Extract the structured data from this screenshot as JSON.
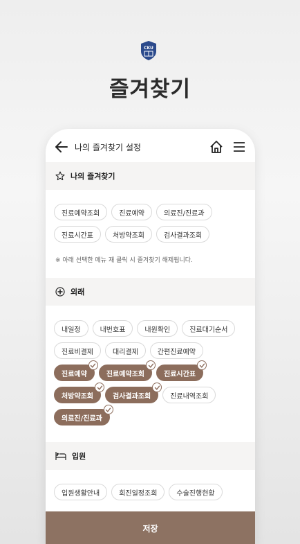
{
  "hero": {
    "logo_text": "CKU",
    "title": "즐겨찾기"
  },
  "appbar": {
    "title": "나의 즐겨찾기 설정"
  },
  "favorites": {
    "title": "나의 즐겨찾기",
    "rows": [
      [
        "진료예약조회",
        "진료예약",
        "의료진/진료과"
      ],
      [
        "진료시간표",
        "처방약조회",
        "검사결과조회"
      ]
    ],
    "note": "※ 아래 선택한 메뉴 재 클릭 시 즐겨찾기 해제됩니다."
  },
  "outpatient": {
    "title": "외래",
    "rows": [
      [
        {
          "label": "내일정",
          "selected": false
        },
        {
          "label": "내번호표",
          "selected": false
        },
        {
          "label": "내원확인",
          "selected": false
        },
        {
          "label": "진료대기순서",
          "selected": false
        }
      ],
      [
        {
          "label": "진료비결제",
          "selected": false
        },
        {
          "label": "대리결제",
          "selected": false
        },
        {
          "label": "간편진료예약",
          "selected": false
        }
      ],
      [
        {
          "label": "진료예약",
          "selected": true
        },
        {
          "label": "진료예약조회",
          "selected": true
        },
        {
          "label": "진료시간표",
          "selected": true
        }
      ],
      [
        {
          "label": "처방약조회",
          "selected": true
        },
        {
          "label": "검사결과조회",
          "selected": true
        },
        {
          "label": "진료내역조회",
          "selected": false
        }
      ],
      [
        {
          "label": "의료진/진료과",
          "selected": true
        }
      ]
    ]
  },
  "inpatient": {
    "title": "입원",
    "rows": [
      [
        "입원생활안내",
        "회진일정조회",
        "수술진행현황"
      ]
    ]
  },
  "save_label": "저장",
  "colors": {
    "accent": "#8c6d5c",
    "save_bar": "#8d7262",
    "logo": "#2b4a8c"
  }
}
